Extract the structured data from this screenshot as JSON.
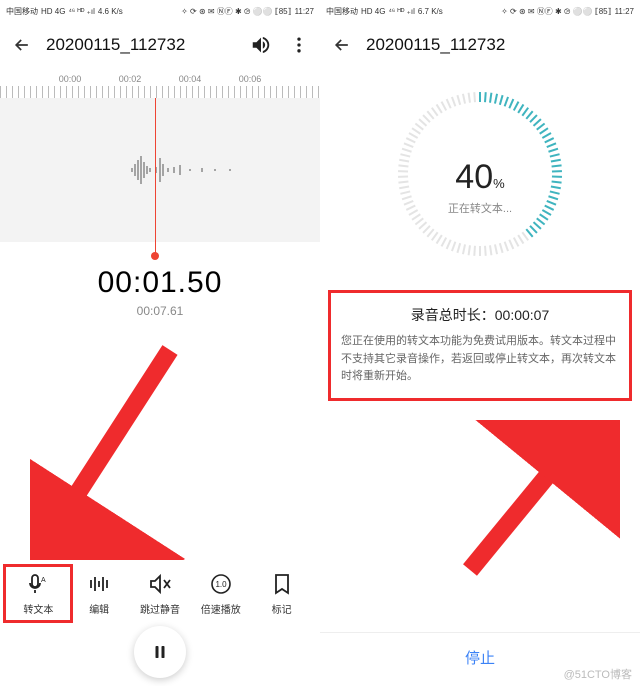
{
  "statusbar": {
    "carrier": "中国移动",
    "net": "HD 4G",
    "speed_left": "4.6 K/s",
    "speed_right": "6.7 K/s",
    "battery": "85",
    "time": "11:27"
  },
  "left": {
    "title": "20200115_112732",
    "timeline": [
      "00:00",
      "00:02",
      "00:04",
      "00:06"
    ],
    "time_current": "00:01.50",
    "time_total": "00:07.61",
    "tools": [
      {
        "label": "转文本",
        "icon": "transcribe-icon"
      },
      {
        "label": "编辑",
        "icon": "edit-icon"
      },
      {
        "label": "跳过静音",
        "icon": "skip-silence-icon"
      },
      {
        "label": "倍速播放",
        "icon": "speed-icon"
      },
      {
        "label": "标记",
        "icon": "bookmark-icon"
      }
    ]
  },
  "right": {
    "title": "20200115_112732",
    "percent": "40",
    "percent_unit": "%",
    "progress_label": "正在转文本...",
    "info_title": "录音总时长：00:00:07",
    "info_body": "您正在使用的转文本功能为免费试用版本。转文本过程中不支持其它录音操作，若返回或停止转文本，再次转文本时将重新开始。",
    "stop_label": "停止"
  },
  "watermark": "@51CTO博客"
}
